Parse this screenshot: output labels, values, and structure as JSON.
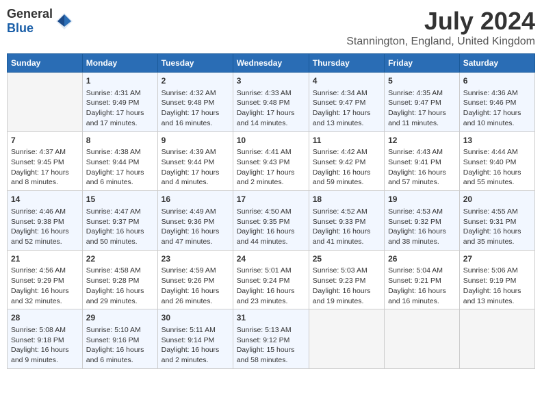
{
  "header": {
    "logo_general": "General",
    "logo_blue": "Blue",
    "month": "July 2024",
    "location": "Stannington, England, United Kingdom"
  },
  "days_of_week": [
    "Sunday",
    "Monday",
    "Tuesday",
    "Wednesday",
    "Thursday",
    "Friday",
    "Saturday"
  ],
  "weeks": [
    [
      {
        "day": "",
        "info": ""
      },
      {
        "day": "1",
        "info": "Sunrise: 4:31 AM\nSunset: 9:49 PM\nDaylight: 17 hours and 17 minutes."
      },
      {
        "day": "2",
        "info": "Sunrise: 4:32 AM\nSunset: 9:48 PM\nDaylight: 17 hours and 16 minutes."
      },
      {
        "day": "3",
        "info": "Sunrise: 4:33 AM\nSunset: 9:48 PM\nDaylight: 17 hours and 14 minutes."
      },
      {
        "day": "4",
        "info": "Sunrise: 4:34 AM\nSunset: 9:47 PM\nDaylight: 17 hours and 13 minutes."
      },
      {
        "day": "5",
        "info": "Sunrise: 4:35 AM\nSunset: 9:47 PM\nDaylight: 17 hours and 11 minutes."
      },
      {
        "day": "6",
        "info": "Sunrise: 4:36 AM\nSunset: 9:46 PM\nDaylight: 17 hours and 10 minutes."
      }
    ],
    [
      {
        "day": "7",
        "info": "Sunrise: 4:37 AM\nSunset: 9:45 PM\nDaylight: 17 hours and 8 minutes."
      },
      {
        "day": "8",
        "info": "Sunrise: 4:38 AM\nSunset: 9:44 PM\nDaylight: 17 hours and 6 minutes."
      },
      {
        "day": "9",
        "info": "Sunrise: 4:39 AM\nSunset: 9:44 PM\nDaylight: 17 hours and 4 minutes."
      },
      {
        "day": "10",
        "info": "Sunrise: 4:41 AM\nSunset: 9:43 PM\nDaylight: 17 hours and 2 minutes."
      },
      {
        "day": "11",
        "info": "Sunrise: 4:42 AM\nSunset: 9:42 PM\nDaylight: 16 hours and 59 minutes."
      },
      {
        "day": "12",
        "info": "Sunrise: 4:43 AM\nSunset: 9:41 PM\nDaylight: 16 hours and 57 minutes."
      },
      {
        "day": "13",
        "info": "Sunrise: 4:44 AM\nSunset: 9:40 PM\nDaylight: 16 hours and 55 minutes."
      }
    ],
    [
      {
        "day": "14",
        "info": "Sunrise: 4:46 AM\nSunset: 9:38 PM\nDaylight: 16 hours and 52 minutes."
      },
      {
        "day": "15",
        "info": "Sunrise: 4:47 AM\nSunset: 9:37 PM\nDaylight: 16 hours and 50 minutes."
      },
      {
        "day": "16",
        "info": "Sunrise: 4:49 AM\nSunset: 9:36 PM\nDaylight: 16 hours and 47 minutes."
      },
      {
        "day": "17",
        "info": "Sunrise: 4:50 AM\nSunset: 9:35 PM\nDaylight: 16 hours and 44 minutes."
      },
      {
        "day": "18",
        "info": "Sunrise: 4:52 AM\nSunset: 9:33 PM\nDaylight: 16 hours and 41 minutes."
      },
      {
        "day": "19",
        "info": "Sunrise: 4:53 AM\nSunset: 9:32 PM\nDaylight: 16 hours and 38 minutes."
      },
      {
        "day": "20",
        "info": "Sunrise: 4:55 AM\nSunset: 9:31 PM\nDaylight: 16 hours and 35 minutes."
      }
    ],
    [
      {
        "day": "21",
        "info": "Sunrise: 4:56 AM\nSunset: 9:29 PM\nDaylight: 16 hours and 32 minutes."
      },
      {
        "day": "22",
        "info": "Sunrise: 4:58 AM\nSunset: 9:28 PM\nDaylight: 16 hours and 29 minutes."
      },
      {
        "day": "23",
        "info": "Sunrise: 4:59 AM\nSunset: 9:26 PM\nDaylight: 16 hours and 26 minutes."
      },
      {
        "day": "24",
        "info": "Sunrise: 5:01 AM\nSunset: 9:24 PM\nDaylight: 16 hours and 23 minutes."
      },
      {
        "day": "25",
        "info": "Sunrise: 5:03 AM\nSunset: 9:23 PM\nDaylight: 16 hours and 19 minutes."
      },
      {
        "day": "26",
        "info": "Sunrise: 5:04 AM\nSunset: 9:21 PM\nDaylight: 16 hours and 16 minutes."
      },
      {
        "day": "27",
        "info": "Sunrise: 5:06 AM\nSunset: 9:19 PM\nDaylight: 16 hours and 13 minutes."
      }
    ],
    [
      {
        "day": "28",
        "info": "Sunrise: 5:08 AM\nSunset: 9:18 PM\nDaylight: 16 hours and 9 minutes."
      },
      {
        "day": "29",
        "info": "Sunrise: 5:10 AM\nSunset: 9:16 PM\nDaylight: 16 hours and 6 minutes."
      },
      {
        "day": "30",
        "info": "Sunrise: 5:11 AM\nSunset: 9:14 PM\nDaylight: 16 hours and 2 minutes."
      },
      {
        "day": "31",
        "info": "Sunrise: 5:13 AM\nSunset: 9:12 PM\nDaylight: 15 hours and 58 minutes."
      },
      {
        "day": "",
        "info": ""
      },
      {
        "day": "",
        "info": ""
      },
      {
        "day": "",
        "info": ""
      }
    ]
  ]
}
